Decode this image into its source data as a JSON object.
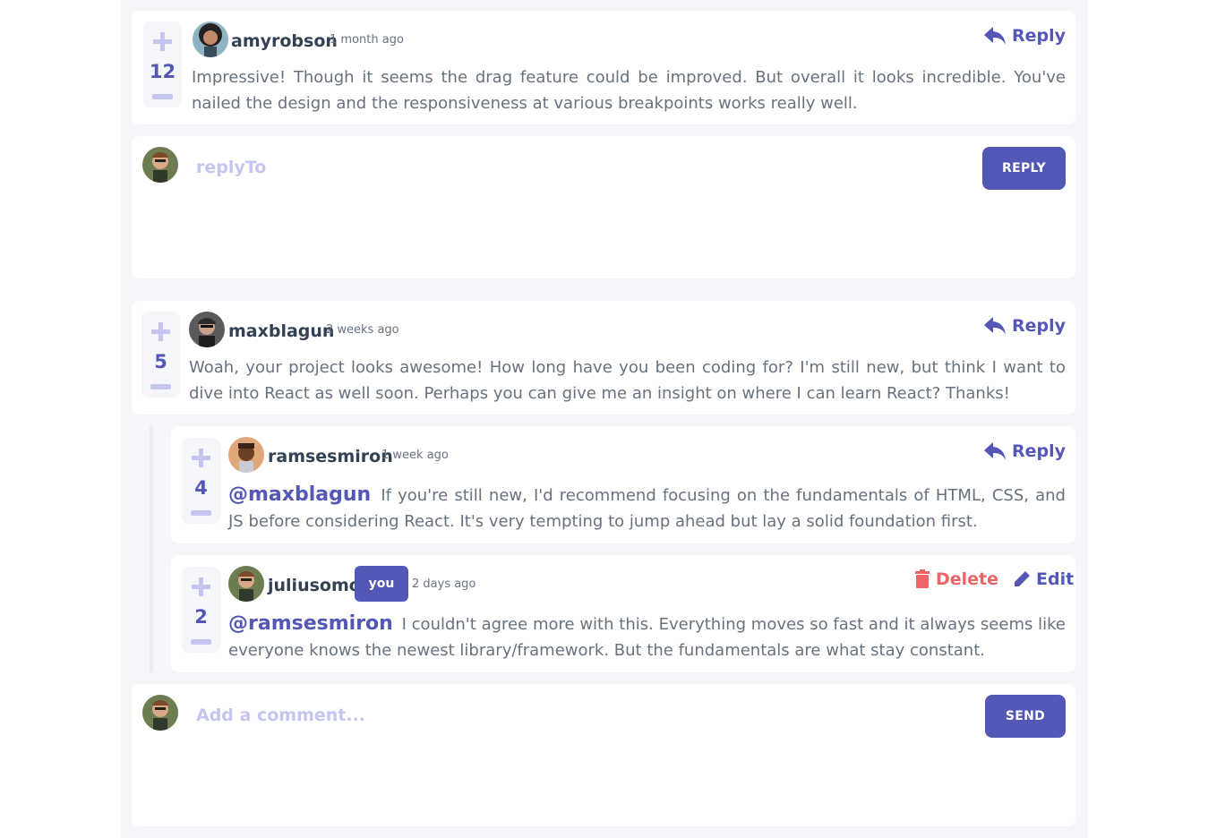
{
  "colors": {
    "accent": "#5357b6",
    "accent_light": "#c5c6ef",
    "danger": "#ed6468",
    "text_dark": "#334253",
    "text_muted": "#67727e",
    "background": "#f5f6fa"
  },
  "comments": [
    {
      "username": "amyrobson",
      "time": "1 month ago",
      "score": "12",
      "content": "Impressive! Though it seems the drag feature could be improved. But overall it looks incredible. You've nailed the design and the responsiveness at various breakpoints works really well.",
      "reply_label": "Reply"
    },
    {
      "username": "maxblagun",
      "time": "2 weeks ago",
      "score": "5",
      "content": "Woah, your project looks awesome! How long have you been coding for? I'm still new, but think I want to dive into React as well soon. Perhaps you can give me an insight on where I can learn React? Thanks!",
      "reply_label": "Reply"
    }
  ],
  "replies": [
    {
      "username": "ramsesmiron",
      "time": "1 week ago",
      "score": "4",
      "mention": "@maxblagun",
      "content": "If you're still new, I'd recommend focusing on the fundamentals of HTML, CSS, and JS before considering React. It's very tempting to jump ahead but lay a solid foundation first.",
      "reply_label": "Reply"
    },
    {
      "username": "juliusomo",
      "you_badge": "you",
      "time": "2 days ago",
      "score": "2",
      "mention": "@ramsesmiron",
      "content": "I couldn't agree more with this. Everything moves so fast and it always seems like everyone knows the newest library/framework. But the fundamentals are what stay constant.",
      "delete_label": "Delete",
      "edit_label": "Edit"
    }
  ],
  "reply_composer": {
    "placeholder": "replyTo",
    "button_label": "REPLY"
  },
  "comment_composer": {
    "placeholder": "Add a comment...",
    "button_label": "SEND"
  }
}
